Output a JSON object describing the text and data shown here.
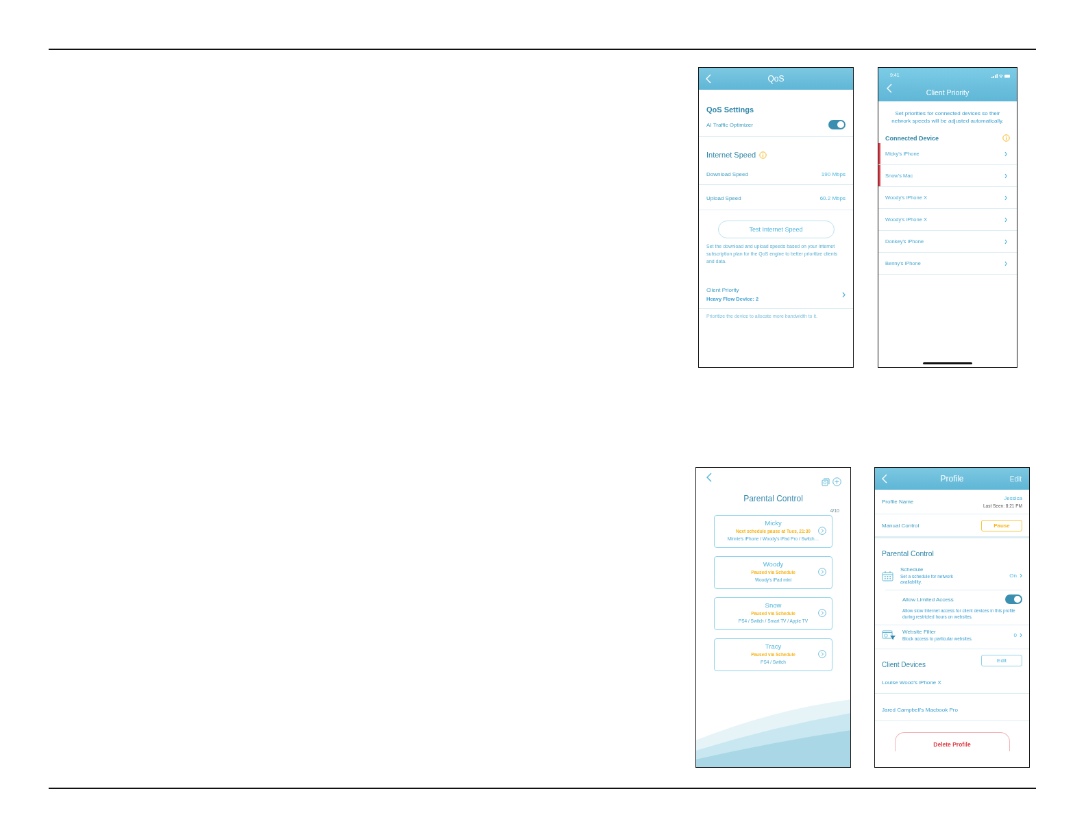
{
  "screens": [
    {
      "kind": "qos",
      "title": "QoS",
      "settings_heading": "QoS Settings",
      "ai_optimizer": {
        "label": "AI Traffic Optimizer",
        "on": true
      },
      "speed_heading": "Internet Speed",
      "speeds": [
        {
          "label": "Download Speed",
          "value": "190 Mbps"
        },
        {
          "label": "Upload Speed",
          "value": "60.2 Mbps"
        }
      ],
      "test_button": "Test Internet Speed",
      "speed_note": "Set the download and upload speeds based on your Internet subscription plan for the QoS engine to better prioritize clients and data.",
      "client_priority": {
        "label": "Client Priority",
        "detail": "Heavy Flow Device: 2"
      },
      "priority_note": "Prioritize the device to allocate more bandwidth to it."
    },
    {
      "kind": "priority",
      "status_time": "9:41",
      "title": "Client Priority",
      "intro": "Set priorities for connected devices so their network speeds will be adjusted automatically.",
      "section": "Connected Device",
      "devices": [
        {
          "name": "Micky's iPhone",
          "prioritized": true
        },
        {
          "name": "Snow's Mac",
          "prioritized": true
        },
        {
          "name": "Woody's iPhone X",
          "prioritized": false
        },
        {
          "name": "Woody's iPhone X",
          "prioritized": false
        },
        {
          "name": "Donkey's iPhone",
          "prioritized": false
        },
        {
          "name": "Benny's iPhone",
          "prioritized": false
        }
      ]
    },
    {
      "kind": "parental",
      "title": "Parental Control",
      "count": "4/10",
      "profiles": [
        {
          "name": "Micky",
          "status": "Next schedule pause at Tues, 21:30",
          "devices": "Minnie's iPhone / Woody's iPad Pro / Switch…"
        },
        {
          "name": "Woody",
          "status": "Paused via Schedule",
          "devices": "Woody's iPad mini"
        },
        {
          "name": "Snow",
          "status": "Paused via Schedule",
          "devices": "PS4 / Switch / Smart TV / Apple TV"
        },
        {
          "name": "Tracy",
          "status": "Paused via Schedule",
          "devices": "PS4 / Switch"
        }
      ]
    },
    {
      "kind": "profile",
      "title": "Profile",
      "header_action": "Edit",
      "profile_name": {
        "label": "Profile Name",
        "value": "Jessica",
        "last_seen": "Last Seen: 8:21 PM"
      },
      "manual_control": {
        "label": "Manual Control",
        "button": "Pause"
      },
      "parental_heading": "Parental Control",
      "schedule": {
        "title": "Schedule",
        "description": "Set a schedule for network availability.",
        "value": "On"
      },
      "limited_access": {
        "title": "Allow Limited Access",
        "on": true,
        "description": "Allow slow Internet access for client devices in this profile during restricted hours on websites."
      },
      "website_filter": {
        "title": "Website Filter",
        "description": "Block access to particular websites.",
        "value": "0"
      },
      "client_heading": "Client Devices",
      "client_edit": "Edit",
      "clients": [
        "Louise Wood's iPhone X",
        "Jared Campbell's Macbook Pro"
      ],
      "delete_button": "Delete Profile"
    }
  ]
}
